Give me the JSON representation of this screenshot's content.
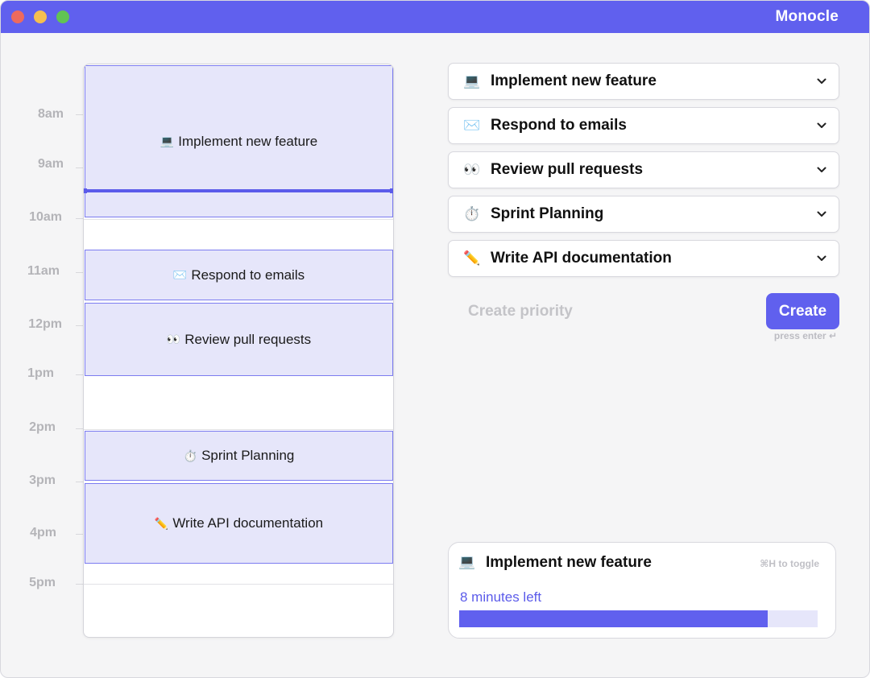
{
  "app": {
    "title": "Monocle"
  },
  "timeline": {
    "hours": [
      "8am",
      "9am",
      "10am",
      "11am",
      "12pm",
      "1pm",
      "2pm",
      "3pm",
      "4pm",
      "5pm"
    ]
  },
  "events": [
    {
      "emoji": "💻",
      "label": "Implement new feature"
    },
    {
      "emoji": "✉️",
      "label": "Respond to emails"
    },
    {
      "emoji": "👀",
      "label": "Review pull requests"
    },
    {
      "emoji": "⏱️",
      "label": "Sprint Planning"
    },
    {
      "emoji": "✏️",
      "label": "Write API documentation"
    }
  ],
  "priorities": [
    {
      "emoji": "💻",
      "label": "Implement new feature"
    },
    {
      "emoji": "✉️",
      "label": "Respond to emails"
    },
    {
      "emoji": "👀",
      "label": "Review pull requests"
    },
    {
      "emoji": "⏱️",
      "label": "Sprint Planning"
    },
    {
      "emoji": "✏️",
      "label": "Write API documentation"
    }
  ],
  "create": {
    "placeholder": "Create priority",
    "button_label": "Create",
    "hint": "press enter ↵"
  },
  "active_task": {
    "emoji": "💻",
    "title": "Implement new feature",
    "toggle_hint": "⌘H to toggle",
    "time_left": "8 minutes left",
    "progress": 0.86
  },
  "colors": {
    "accent": "#6060ee",
    "event_bg": "#e6e6fa",
    "event_border": "#7c7cf0"
  }
}
